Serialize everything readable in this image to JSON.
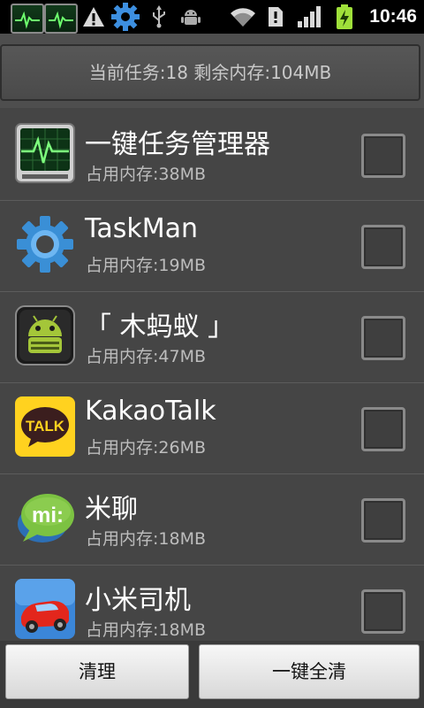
{
  "status_bar": {
    "icons": [
      "task-monitor-thumb-icon",
      "task-monitor-thumb-icon",
      "warning-icon",
      "gear-icon",
      "usb-icon",
      "android-icon",
      "wifi-icon",
      "sim-icon",
      "signal-icon",
      "battery-charging-icon"
    ],
    "time": "10:46"
  },
  "summary": {
    "text": "当前任务:18 剩余内存:104MB"
  },
  "apps": [
    {
      "name": "一键任务管理器",
      "memory": "占用内存:38MB",
      "icon": "heart-monitor-icon"
    },
    {
      "name": "TaskMan",
      "memory": "占用内存:19MB",
      "icon": "gear-icon"
    },
    {
      "name": "「 木蚂蚁 」",
      "memory": "占用内存:47MB",
      "icon": "android-robot-icon"
    },
    {
      "name": "KakaoTalk",
      "memory": "占用内存:26MB",
      "icon": "kakaotalk-icon",
      "icon_text": "TALK"
    },
    {
      "name": "米聊",
      "memory": "占用内存:18MB",
      "icon": "miliao-icon",
      "icon_text": "mi:"
    },
    {
      "name": "小米司机",
      "memory": "占用内存:18MB",
      "icon": "car-icon"
    }
  ],
  "buttons": {
    "clean": "清理",
    "clean_all": "一键全清"
  },
  "colors": {
    "background": "#454545",
    "accent_blue": "#3a8fd6",
    "kakao_yellow": "#ffd21f",
    "miliao_green": "#7cc242"
  }
}
